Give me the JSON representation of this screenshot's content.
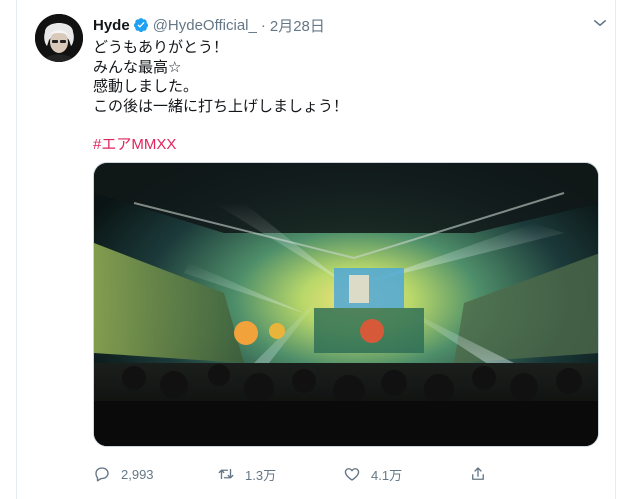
{
  "user": {
    "display_name": "Hyde",
    "handle": "@HydeOfficial_",
    "separator": "·",
    "date": "2月28日",
    "verified": true
  },
  "tweet": {
    "lines": [
      "どうもありがとう！",
      "みんな最高☆",
      "感動しました。",
      "この後は一緒に打ち上げしましょう！"
    ],
    "hashtag": "#エアMMXX"
  },
  "actions": {
    "reply_count": "2,993",
    "retweet_count": "1.3万",
    "like_count": "4.1万"
  },
  "colors": {
    "text": "#14171a",
    "secondary": "#657786",
    "hashtag": "#e0245e",
    "verified": "#1da1f2"
  },
  "icons": [
    "verified-badge-icon",
    "chevron-down-icon",
    "reply-icon",
    "retweet-icon",
    "like-icon",
    "share-icon"
  ]
}
